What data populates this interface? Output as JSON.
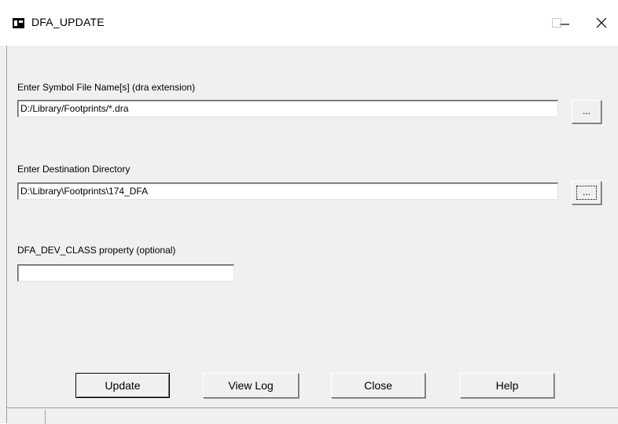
{
  "window": {
    "title": "DFA_UPDATE",
    "minimize_glyph": "—",
    "maximize_glyph": "☐",
    "close_glyph": "✕"
  },
  "symbol": {
    "label": "Enter Symbol File Name[s] (dra extension)",
    "value": "D:/Library/Footprints/*.dra",
    "browse_label": "..."
  },
  "destination": {
    "label": "Enter Destination Directory",
    "value": "D:\\Library\\Footprints\\174_DFA",
    "browse_label": "..."
  },
  "dev_class": {
    "label": "DFA_DEV_CLASS property (optional)",
    "value": ""
  },
  "buttons": {
    "update": "Update",
    "view_log": "View Log",
    "close": "Close",
    "help": "Help"
  },
  "icons": {
    "app": "app-window-icon",
    "minimize": "minimize-icon",
    "maximize": "maximize-icon",
    "close": "close-icon"
  }
}
